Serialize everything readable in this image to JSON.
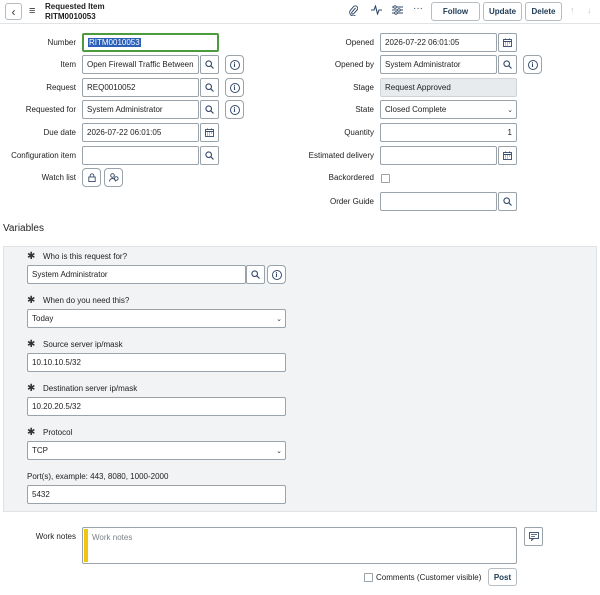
{
  "header": {
    "record_type": "Requested Item",
    "record_number": "RITM0010053",
    "follow_label": "Follow",
    "update_label": "Update",
    "delete_label": "Delete"
  },
  "form": {
    "number": {
      "label": "Number",
      "value": "RITM0010053"
    },
    "item": {
      "label": "Item",
      "value": "Open Firewall Traffic Between"
    },
    "request": {
      "label": "Request",
      "value": "REQ0010052"
    },
    "requested_for": {
      "label": "Requested for",
      "value": "System Administrator"
    },
    "due_date": {
      "label": "Due date",
      "value": "2026-07-22 06:01:05"
    },
    "configuration_item": {
      "label": "Configuration item",
      "value": ""
    },
    "watch_list": {
      "label": "Watch list"
    },
    "opened": {
      "label": "Opened",
      "value": "2026-07-22 06:01:05"
    },
    "opened_by": {
      "label": "Opened by",
      "value": "System Administrator"
    },
    "stage": {
      "label": "Stage",
      "value": "Request Approved"
    },
    "state": {
      "label": "State",
      "value": "Closed Complete"
    },
    "quantity": {
      "label": "Quantity",
      "value": "1"
    },
    "estimated_delivery": {
      "label": "Estimated delivery",
      "value": ""
    },
    "backordered": {
      "label": "Backordered"
    },
    "order_guide": {
      "label": "Order Guide",
      "value": ""
    }
  },
  "variables": {
    "title": "Variables",
    "who_for": {
      "label": "Who is this request for?",
      "value": "System Administrator"
    },
    "when_need": {
      "label": "When do you need this?",
      "value": "Today"
    },
    "source_ip": {
      "label": "Source server ip/mask",
      "value": "10.10.10.5/32"
    },
    "dest_ip": {
      "label": "Destination server ip/mask",
      "value": "10.20.20.5/32"
    },
    "protocol": {
      "label": "Protocol",
      "value": "TCP"
    },
    "ports": {
      "label": "Port(s), example: 443, 8080, 1000-2000",
      "value": "5432"
    }
  },
  "work_notes": {
    "label": "Work notes",
    "placeholder": "Work notes",
    "comments_label": "Comments (Customer visible)",
    "post_label": "Post"
  },
  "colors": {
    "accent": "#1d3a55",
    "highlight": "#4d9b3f",
    "work_notes_marker": "#f1c40f"
  }
}
